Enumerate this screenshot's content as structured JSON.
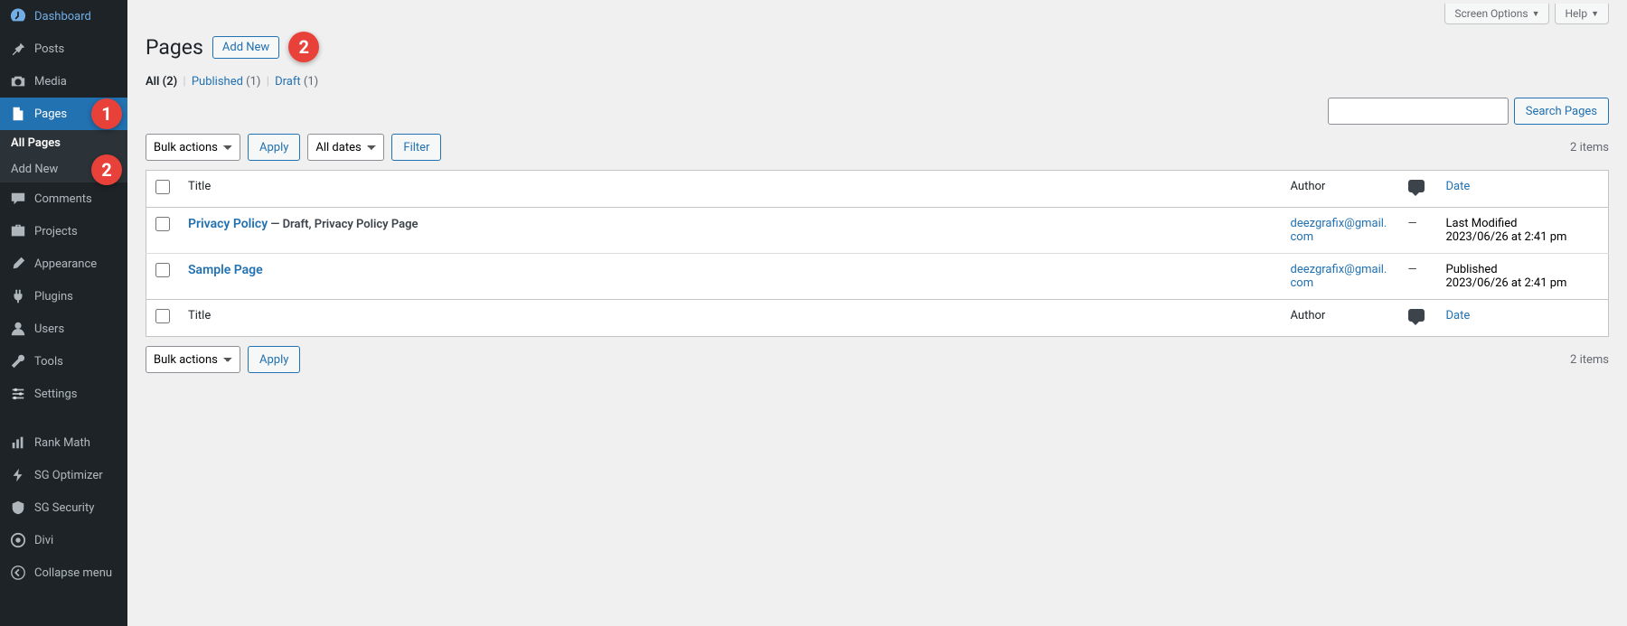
{
  "sidebar": {
    "items": [
      {
        "label": "Dashboard",
        "icon": "speedometer"
      },
      {
        "label": "Posts",
        "icon": "pin"
      },
      {
        "label": "Media",
        "icon": "camera"
      },
      {
        "label": "Pages",
        "icon": "page",
        "active": true,
        "badge": "1"
      },
      {
        "label": "Comments",
        "icon": "chat"
      },
      {
        "label": "Projects",
        "icon": "briefcase"
      },
      {
        "label": "Appearance",
        "icon": "brush"
      },
      {
        "label": "Plugins",
        "icon": "plug"
      },
      {
        "label": "Users",
        "icon": "user"
      },
      {
        "label": "Tools",
        "icon": "wrench"
      },
      {
        "label": "Settings",
        "icon": "sliders"
      },
      {
        "label": "Rank Math",
        "icon": "chart"
      },
      {
        "label": "SG Optimizer",
        "icon": "bolt"
      },
      {
        "label": "SG Security",
        "icon": "shield"
      },
      {
        "label": "Divi",
        "icon": "divi"
      },
      {
        "label": "Collapse menu",
        "icon": "collapse"
      }
    ],
    "submenu": [
      {
        "label": "All Pages",
        "current": true
      },
      {
        "label": "Add New",
        "badge": "2"
      }
    ]
  },
  "topbar": {
    "screen_options": "Screen Options",
    "help": "Help"
  },
  "heading": {
    "title": "Pages",
    "add_new": "Add New",
    "badge": "2"
  },
  "filters": {
    "all_label": "All",
    "all_count": "(2)",
    "published_label": "Published",
    "published_count": "(1)",
    "draft_label": "Draft",
    "draft_count": "(1)"
  },
  "search": {
    "button": "Search Pages"
  },
  "actions": {
    "bulk": "Bulk actions",
    "apply": "Apply",
    "all_dates": "All dates",
    "filter": "Filter",
    "items_count": "2 items"
  },
  "columns": {
    "title": "Title",
    "author": "Author",
    "date": "Date"
  },
  "rows": [
    {
      "title": "Privacy Policy",
      "state": " — Draft, Privacy Policy Page",
      "author": "deezgrafix@gmail.com",
      "comments_dash": "—",
      "date_label": "Last Modified",
      "date_value": "2023/06/26 at 2:41 pm"
    },
    {
      "title": "Sample Page",
      "state": "",
      "author": "deezgrafix@gmail.com",
      "comments_dash": "—",
      "date_label": "Published",
      "date_value": "2023/06/26 at 2:41 pm"
    }
  ]
}
